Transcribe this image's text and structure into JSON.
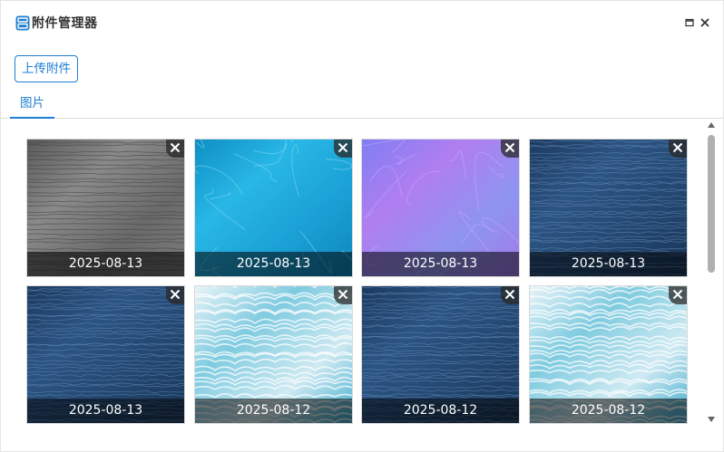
{
  "window": {
    "title": "附件管理器",
    "icon": "attachment-manager-icon",
    "controls": {
      "maximize_icon": "maximize-icon",
      "close_icon": "close-icon"
    }
  },
  "toolbar": {
    "upload_label": "上传附件"
  },
  "tabs": [
    {
      "label": "图片",
      "active": true
    }
  ],
  "images": [
    {
      "date": "2025-08-13",
      "texture": "gray-water"
    },
    {
      "date": "2025-08-13",
      "texture": "cyan-water"
    },
    {
      "date": "2025-08-13",
      "texture": "normal-map"
    },
    {
      "date": "2025-08-13",
      "texture": "deep-blue-ocean"
    },
    {
      "date": "2025-08-13",
      "texture": "deep-blue-ocean"
    },
    {
      "date": "2025-08-12",
      "texture": "light-waves"
    },
    {
      "date": "2025-08-12",
      "texture": "deep-blue-ocean"
    },
    {
      "date": "2025-08-12",
      "texture": "light-waves"
    }
  ],
  "colors": {
    "accent": "#1e7fd3",
    "border": "#dcdcdc",
    "scroll_thumb": "#b0b0b0"
  }
}
